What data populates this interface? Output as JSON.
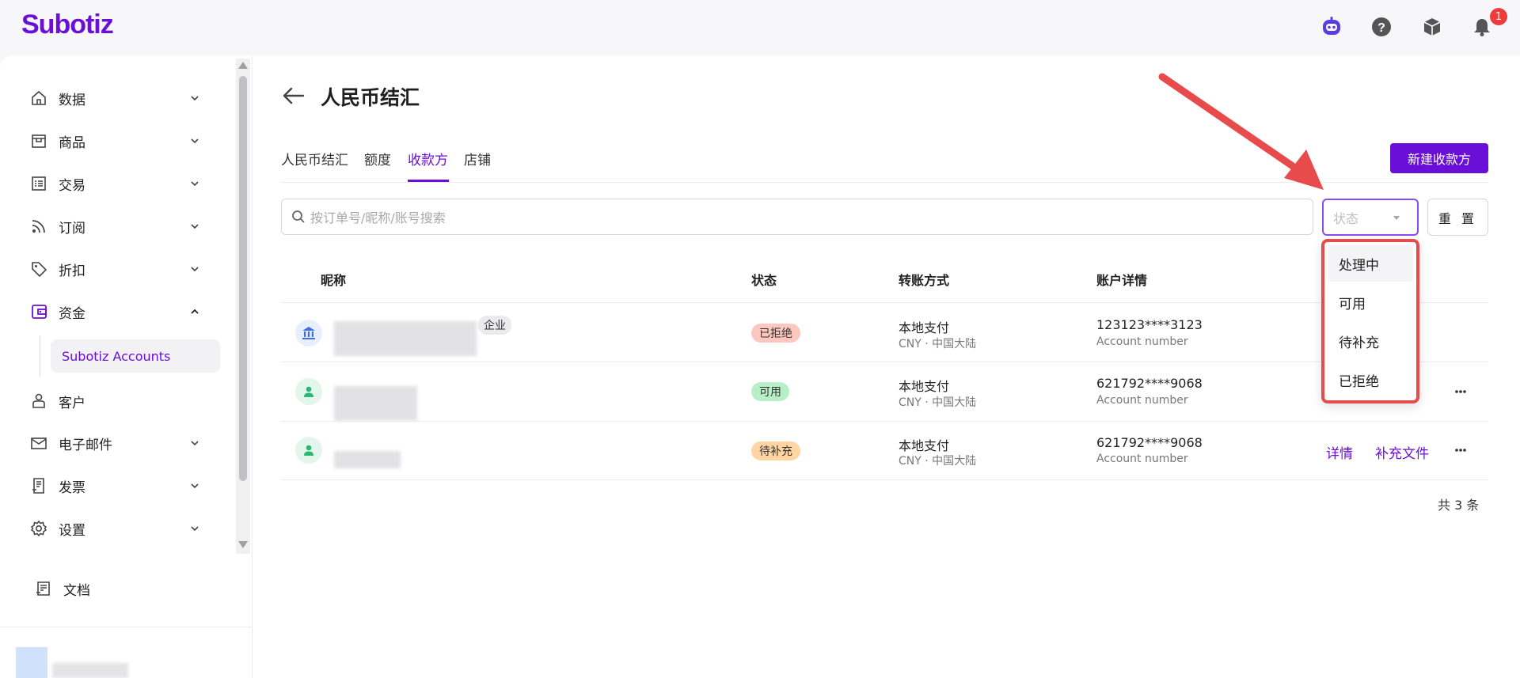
{
  "app": {
    "logo_text": "Subotiz",
    "notification_count": "1"
  },
  "topbar": {
    "icons": [
      "assistant-bot-icon",
      "help-icon",
      "package-icon",
      "bell-icon"
    ]
  },
  "sidebar": {
    "items": [
      {
        "label": "数据",
        "icon": "home-icon"
      },
      {
        "label": "商品",
        "icon": "box-icon"
      },
      {
        "label": "交易",
        "icon": "list-icon"
      },
      {
        "label": "订阅",
        "icon": "rss-icon"
      },
      {
        "label": "折扣",
        "icon": "tag-icon"
      },
      {
        "label": "资金",
        "icon": "wallet-icon"
      },
      {
        "label": "客户",
        "icon": "person-icon"
      },
      {
        "label": "电子邮件",
        "icon": "mail-icon"
      },
      {
        "label": "发票",
        "icon": "invoice-icon"
      },
      {
        "label": "设置",
        "icon": "gear-icon"
      },
      {
        "label": "文档",
        "icon": "docs-icon"
      }
    ],
    "sub_item": "Subotiz Accounts"
  },
  "page": {
    "title": "人民币结汇",
    "tabs": [
      "人民币结汇",
      "额度",
      "收款方",
      "店铺"
    ],
    "active_tab": "收款方",
    "new_button": "新建收款方"
  },
  "filters": {
    "search_placeholder": "按订单号/昵称/账号搜索",
    "status_placeholder": "状态",
    "reset_label": "重 置"
  },
  "dropdown": {
    "options": [
      "处理中",
      "可用",
      "待补充",
      "已拒绝"
    ]
  },
  "table": {
    "headers": [
      "昵称",
      "状态",
      "转账方式",
      "账户详情"
    ],
    "rows": [
      {
        "type_icon": "bank-icon",
        "tag": "企业",
        "status": "已拒绝",
        "method": "本地支付",
        "method_sub": "CNY · 中国大陆",
        "account": "123123****3123",
        "account_sub": "Account number"
      },
      {
        "type_icon": "person-icon",
        "tag": "",
        "status": "可用",
        "method": "本地支付",
        "method_sub": "CNY · 中国大陆",
        "account": "621792****9068",
        "account_sub": "Account number"
      },
      {
        "type_icon": "person-icon",
        "tag": "",
        "status": "待补充",
        "method": "本地支付",
        "method_sub": "CNY · 中国大陆",
        "account": "621792****9068",
        "account_sub": "Account number",
        "actions": [
          "详情",
          "补充文件"
        ]
      }
    ],
    "total": "共 3 条"
  },
  "colors": {
    "brand": "#6a0fd8",
    "annotation_red": "#e74b4b"
  }
}
